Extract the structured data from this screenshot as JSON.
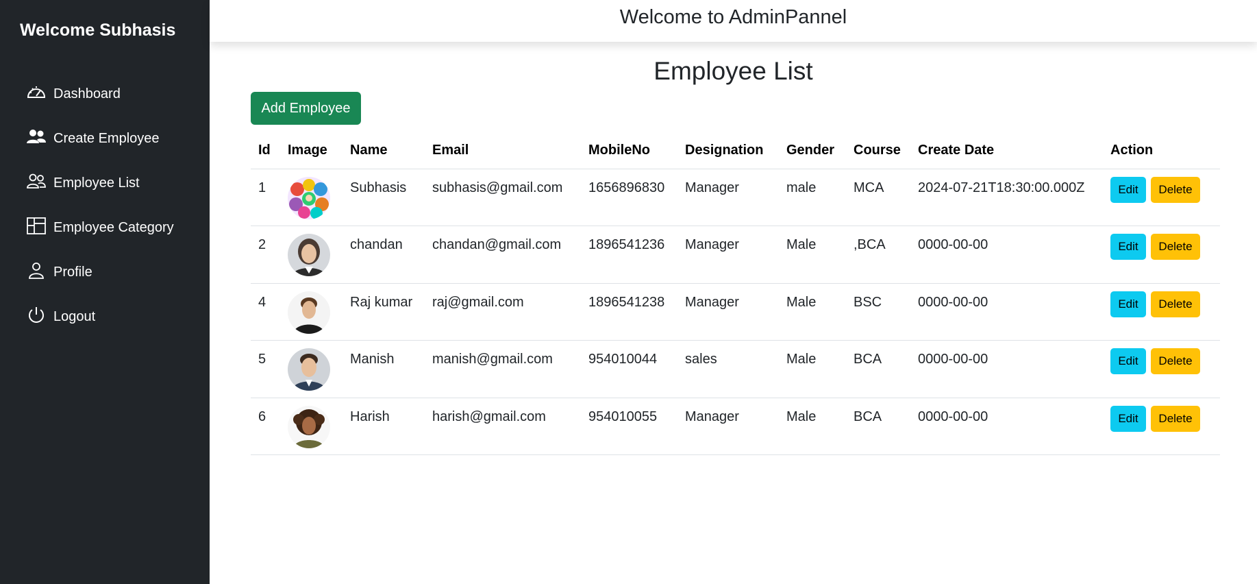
{
  "sidebar": {
    "brand": "Welcome Subhasis",
    "items": [
      {
        "label": "Dashboard",
        "icon": "speedometer-icon"
      },
      {
        "label": "Create Employee",
        "icon": "people-fill-icon"
      },
      {
        "label": "Employee List",
        "icon": "people-outline-icon"
      },
      {
        "label": "Employee Category",
        "icon": "columns-gap-icon"
      },
      {
        "label": "Profile",
        "icon": "person-icon"
      },
      {
        "label": "Logout",
        "icon": "power-icon"
      }
    ]
  },
  "header": {
    "title": "Welcome to AdminPannel"
  },
  "main": {
    "title": "Employee List",
    "add_button": "Add Employee",
    "columns": [
      "Id",
      "Image",
      "Name",
      "Email",
      "MobileNo",
      "Designation",
      "Gender",
      "Course",
      "Create Date",
      "Action"
    ],
    "rows": [
      {
        "id": "1",
        "name": "Subhasis",
        "email": "subhasis@gmail.com",
        "mobile": "1656896830",
        "designation": "Manager",
        "gender": "male",
        "course": "MCA",
        "create_date": "2024-07-21T18:30:00.000Z",
        "edit": "Edit",
        "delete": "Delete",
        "avatar": "colorful-group-avatar"
      },
      {
        "id": "2",
        "name": "chandan",
        "email": "chandan@gmail.com",
        "mobile": "1896541236",
        "designation": "Manager",
        "gender": "Male",
        "course": ",BCA",
        "create_date": "0000-00-00",
        "edit": "Edit",
        "delete": "Delete",
        "avatar": "woman-portrait-avatar"
      },
      {
        "id": "4",
        "name": "Raj kumar",
        "email": "raj@gmail.com",
        "mobile": "1896541238",
        "designation": "Manager",
        "gender": "Male",
        "course": "BSC",
        "create_date": "0000-00-00",
        "edit": "Edit",
        "delete": "Delete",
        "avatar": "man-portrait-avatar"
      },
      {
        "id": "5",
        "name": "Manish",
        "email": "manish@gmail.com",
        "mobile": "954010044",
        "designation": "sales",
        "gender": "Male",
        "course": "BCA",
        "create_date": "0000-00-00",
        "edit": "Edit",
        "delete": "Delete",
        "avatar": "man-smiling-avatar"
      },
      {
        "id": "6",
        "name": "Harish",
        "email": "harish@gmail.com",
        "mobile": "954010055",
        "designation": "Manager",
        "gender": "Male",
        "course": "BCA",
        "create_date": "0000-00-00",
        "edit": "Edit",
        "delete": "Delete",
        "avatar": "woman-curly-avatar"
      }
    ]
  },
  "colors": {
    "sidebar_bg": "#212529",
    "add_button": "#198754",
    "edit_button": "#0dcaf0",
    "delete_button": "#ffc107"
  }
}
